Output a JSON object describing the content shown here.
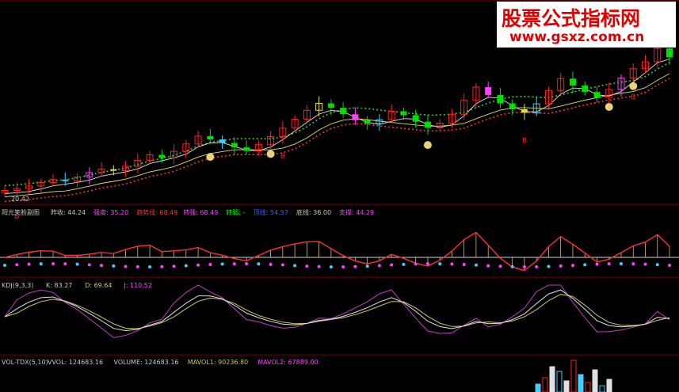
{
  "watermark": {
    "title": "股票公式指标网",
    "url": "www.gsxz.com.cn"
  },
  "price_panel": {
    "price_label": "20.42",
    "markers_b": [
      "B",
      "B",
      "B",
      "B"
    ]
  },
  "indicator_panel": {
    "name": "阳光笑脸副图",
    "items": [
      {
        "label": "昨收: 44.24",
        "color": "#c8c8c8"
      },
      {
        "label": "强度: 35.20",
        "color": "#ff40ff"
      },
      {
        "label": "趋势线: 68.49",
        "color": "#ff3030"
      },
      {
        "label": "转强: 68.49",
        "color": "#ff40ff"
      },
      {
        "label": "转弱: -",
        "color": "#00ff00"
      },
      {
        "label": "顶线: 54.57",
        "color": "#4060ff"
      },
      {
        "label": "底线: 36.00",
        "color": "#c8c8c8"
      },
      {
        "label": "支撑: 44.29",
        "color": "#ff40ff"
      }
    ]
  },
  "kdj_panel": {
    "name": "KDJ(9,3,3)",
    "items": [
      {
        "label": "K: 83.27",
        "color": "#c8c8c8"
      },
      {
        "label": "D: 69.64",
        "color": "#c8c860"
      },
      {
        "label": "J: 110.52",
        "color": "#ff40ff"
      }
    ]
  },
  "vol_panel": {
    "name": "VOL-TDX(5,10)",
    "items": [
      {
        "label": "VVOL: 124683.16",
        "color": "#c8c8c8"
      },
      {
        "label": "VOLUME: 124683.16",
        "color": "#c8c8c8"
      },
      {
        "label": "MAVOL1: 90236.80",
        "color": "#c8c860"
      },
      {
        "label": "MAVOL2: 67889.00",
        "color": "#ff40ff"
      }
    ]
  },
  "colors": {
    "up": "#ff2020",
    "down": "#00e000",
    "pink": "#ff40ff",
    "cyan": "#40d0ff",
    "yellow": "#e0e040"
  },
  "chart_data": {
    "type": "candlestick",
    "title": "",
    "series": [
      {
        "name": "close_trend",
        "values": [
          15.2,
          15.6,
          16.1,
          16.8,
          17.4,
          17.1,
          17.9,
          18.8,
          19.5,
          19.2,
          20.1,
          21.3,
          22.4,
          21.8,
          23.1,
          24.6,
          26.2,
          25.5,
          24.8,
          23.9,
          23.2,
          24.5,
          26.1,
          27.8,
          29.6,
          31.4,
          32.8,
          31.9,
          30.6,
          29.4,
          28.7,
          29.5,
          31.2,
          30.4,
          29.1,
          27.9,
          28.8,
          30.6,
          33.4,
          36.1,
          34.5,
          32.8,
          31.6,
          30.9,
          32.7,
          35.4,
          37.8,
          36.4,
          35.1,
          34.0,
          35.6,
          37.9,
          39.8,
          41.2,
          43.9,
          42.1
        ]
      }
    ]
  }
}
